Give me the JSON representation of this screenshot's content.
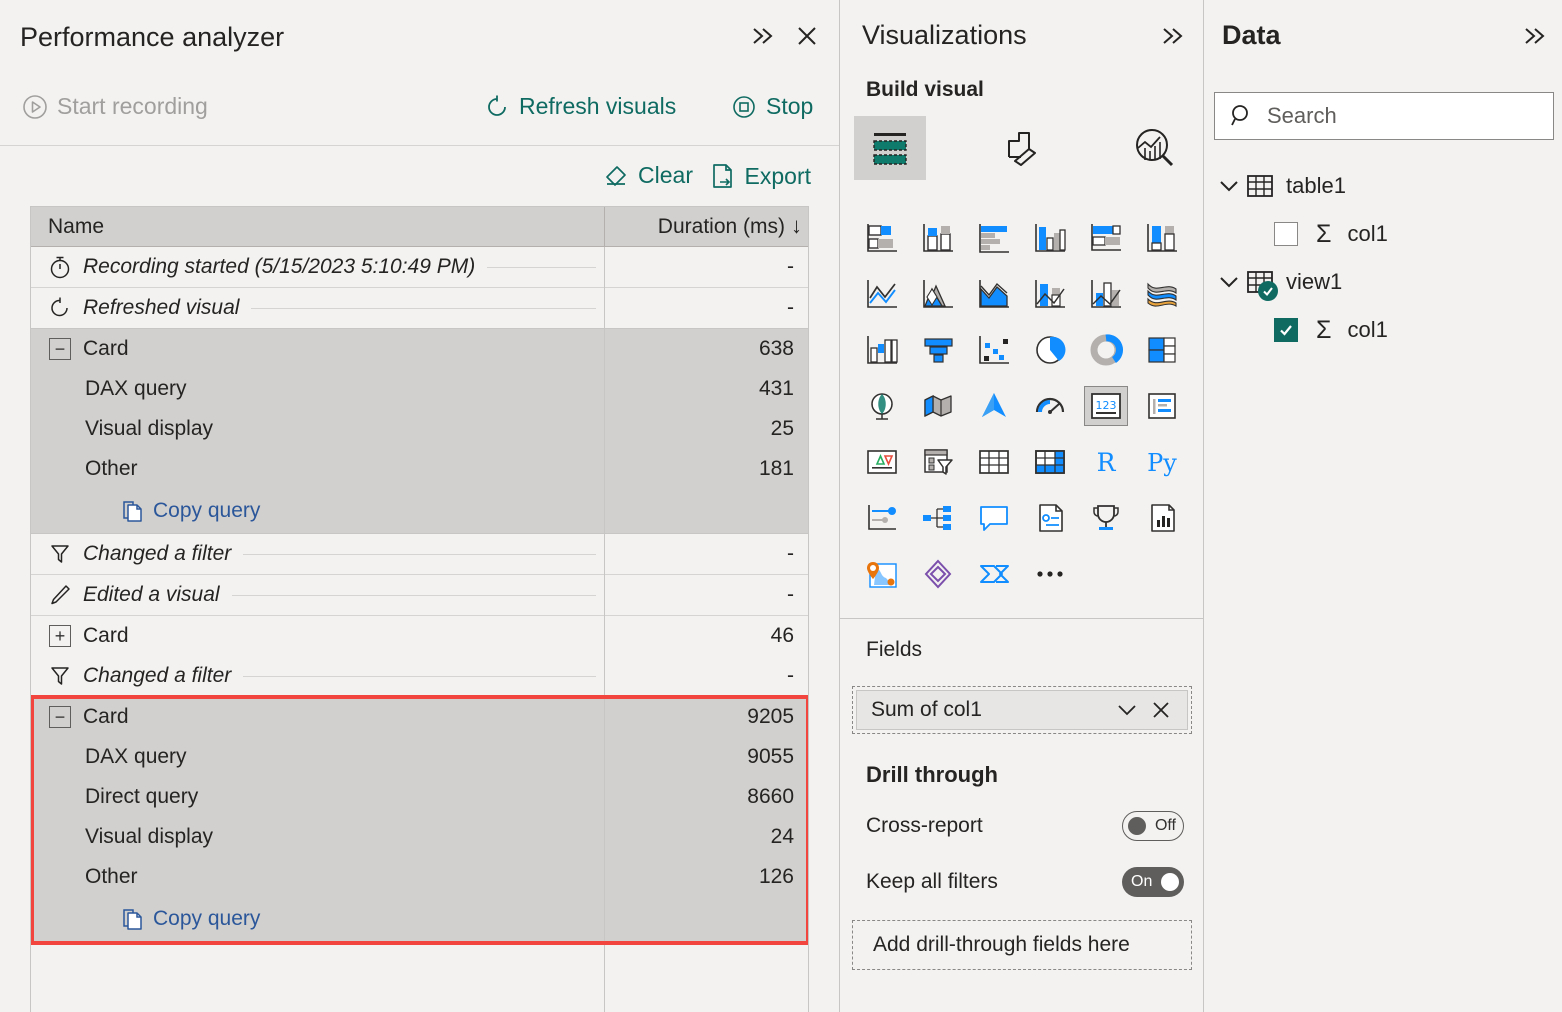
{
  "performance_analyzer": {
    "title": "Performance analyzer",
    "header_icons": [
      {
        "name": "collapse-chevrons-icon",
        "glyph": "»"
      },
      {
        "name": "close-icon",
        "glyph": "✕"
      }
    ],
    "actions": {
      "start_recording": "Start recording",
      "refresh_visuals": "Refresh visuals",
      "stop": "Stop",
      "clear": "Clear",
      "export": "Export"
    },
    "table": {
      "columns": [
        "Name",
        "Duration (ms)"
      ],
      "sort_indicator": "↓",
      "copy_query_label": "Copy query",
      "groups": [
        {
          "style": "plain",
          "rows": [
            {
              "icon": "stopwatch-icon",
              "label": "Recording started (5/15/2023 5:10:49 PM)",
              "duration": "-",
              "italic": true,
              "leader": true
            },
            {
              "icon": "refresh-icon",
              "label": "Refreshed visual",
              "duration": "-",
              "italic": true,
              "leader": true
            }
          ],
          "copy_query": false,
          "highlighted": false
        },
        {
          "style": "shaded",
          "rows": [
            {
              "icon": "collapse-minus-icon",
              "label": "Card",
              "duration": "638",
              "italic": false,
              "leader": false
            },
            {
              "icon": "",
              "label": "DAX query",
              "duration": "431",
              "italic": false,
              "leader": false,
              "child": true
            },
            {
              "icon": "",
              "label": "Visual display",
              "duration": "25",
              "italic": false,
              "leader": false,
              "child": true
            },
            {
              "icon": "",
              "label": "Other",
              "duration": "181",
              "italic": false,
              "leader": false,
              "child": true
            }
          ],
          "copy_query": true,
          "highlighted": false
        },
        {
          "style": "plain",
          "rows": [
            {
              "icon": "filter-icon",
              "label": "Changed a filter",
              "duration": "-",
              "italic": true,
              "leader": true
            },
            {
              "icon": "pencil-icon",
              "label": "Edited a visual",
              "duration": "-",
              "italic": true,
              "leader": true
            },
            {
              "icon": "expand-plus-icon",
              "label": "Card",
              "duration": "46",
              "italic": false,
              "leader": false
            },
            {
              "icon": "filter-icon",
              "label": "Changed a filter",
              "duration": "-",
              "italic": true,
              "leader": true
            }
          ],
          "copy_query": false,
          "highlighted": false
        },
        {
          "style": "shaded",
          "rows": [
            {
              "icon": "collapse-minus-icon",
              "label": "Card",
              "duration": "9205",
              "italic": false,
              "leader": false
            },
            {
              "icon": "",
              "label": "DAX query",
              "duration": "9055",
              "italic": false,
              "leader": false,
              "child": true
            },
            {
              "icon": "",
              "label": "Direct query",
              "duration": "8660",
              "italic": false,
              "leader": false,
              "child": true
            },
            {
              "icon": "",
              "label": "Visual display",
              "duration": "24",
              "italic": false,
              "leader": false,
              "child": true
            },
            {
              "icon": "",
              "label": "Other",
              "duration": "126",
              "italic": false,
              "leader": false,
              "child": true
            }
          ],
          "copy_query": true,
          "highlighted": true
        }
      ]
    }
  },
  "visualizations": {
    "title": "Visualizations",
    "chevron": "»",
    "build_visual": "Build visual",
    "tabs": [
      {
        "name": "fields-tab",
        "selected": true
      },
      {
        "name": "format-tab",
        "selected": false
      },
      {
        "name": "analytics-tab",
        "selected": false
      }
    ],
    "visual_icons": [
      "stacked-bar-chart-icon",
      "stacked-column-chart-icon",
      "clustered-bar-chart-icon",
      "clustered-column-chart-icon",
      "100-percent-stacked-bar-chart-icon",
      "100-percent-stacked-column-chart-icon",
      "line-chart-icon",
      "area-chart-icon",
      "stacked-area-chart-icon",
      "line-and-stacked-column-chart-icon",
      "line-and-clustered-column-chart-icon",
      "ribbon-chart-icon",
      "waterfall-chart-icon",
      "funnel-chart-icon",
      "scatter-chart-icon",
      "pie-chart-icon",
      "donut-chart-icon",
      "treemap-icon",
      "map-icon",
      "filled-map-icon",
      "azure-map-icon",
      "gauge-icon",
      "card-icon",
      "multi-row-card-icon",
      "kpi-icon",
      "slicer-icon",
      "table-icon",
      "matrix-icon",
      "r-script-visual-icon",
      "python-visual-icon",
      "key-influencers-icon",
      "decomposition-tree-icon",
      "qna-icon",
      "smart-narrative-icon",
      "metrics-icon",
      "paginated-report-icon",
      "arcgis-map-icon",
      "power-apps-icon",
      "power-automate-icon",
      "more-options-icon"
    ],
    "selected_visual_icon": "card-icon",
    "fields": {
      "label": "Fields",
      "pill": "Sum of col1",
      "pill_dropdown_icon": "chevron-down-icon",
      "pill_remove_icon": "close-icon"
    },
    "drill_through": {
      "label": "Drill through",
      "cross_report": {
        "label": "Cross-report",
        "state": "Off"
      },
      "keep_all_filters": {
        "label": "Keep all filters",
        "state": "On"
      },
      "drop_zone": "Add drill-through fields here"
    }
  },
  "data": {
    "title": "Data",
    "chevron": "»",
    "search_placeholder": "Search",
    "search_value": "",
    "search_icon": "search-icon",
    "tree": [
      {
        "name": "table1",
        "expanded": true,
        "has_view_badge": false,
        "children": [
          {
            "name": "col1",
            "checked": false,
            "aggregation_icon": "sigma-icon"
          }
        ]
      },
      {
        "name": "view1",
        "expanded": true,
        "has_view_badge": true,
        "children": [
          {
            "name": "col1",
            "checked": true,
            "aggregation_icon": "sigma-icon"
          }
        ]
      }
    ]
  },
  "colors": {
    "accent_teal": "#0f6b62",
    "link_blue": "#2b579a",
    "highlight_red": "#f1453d",
    "panel_bg": "#f3f2f1",
    "row_shaded": "#d2d0ce"
  }
}
